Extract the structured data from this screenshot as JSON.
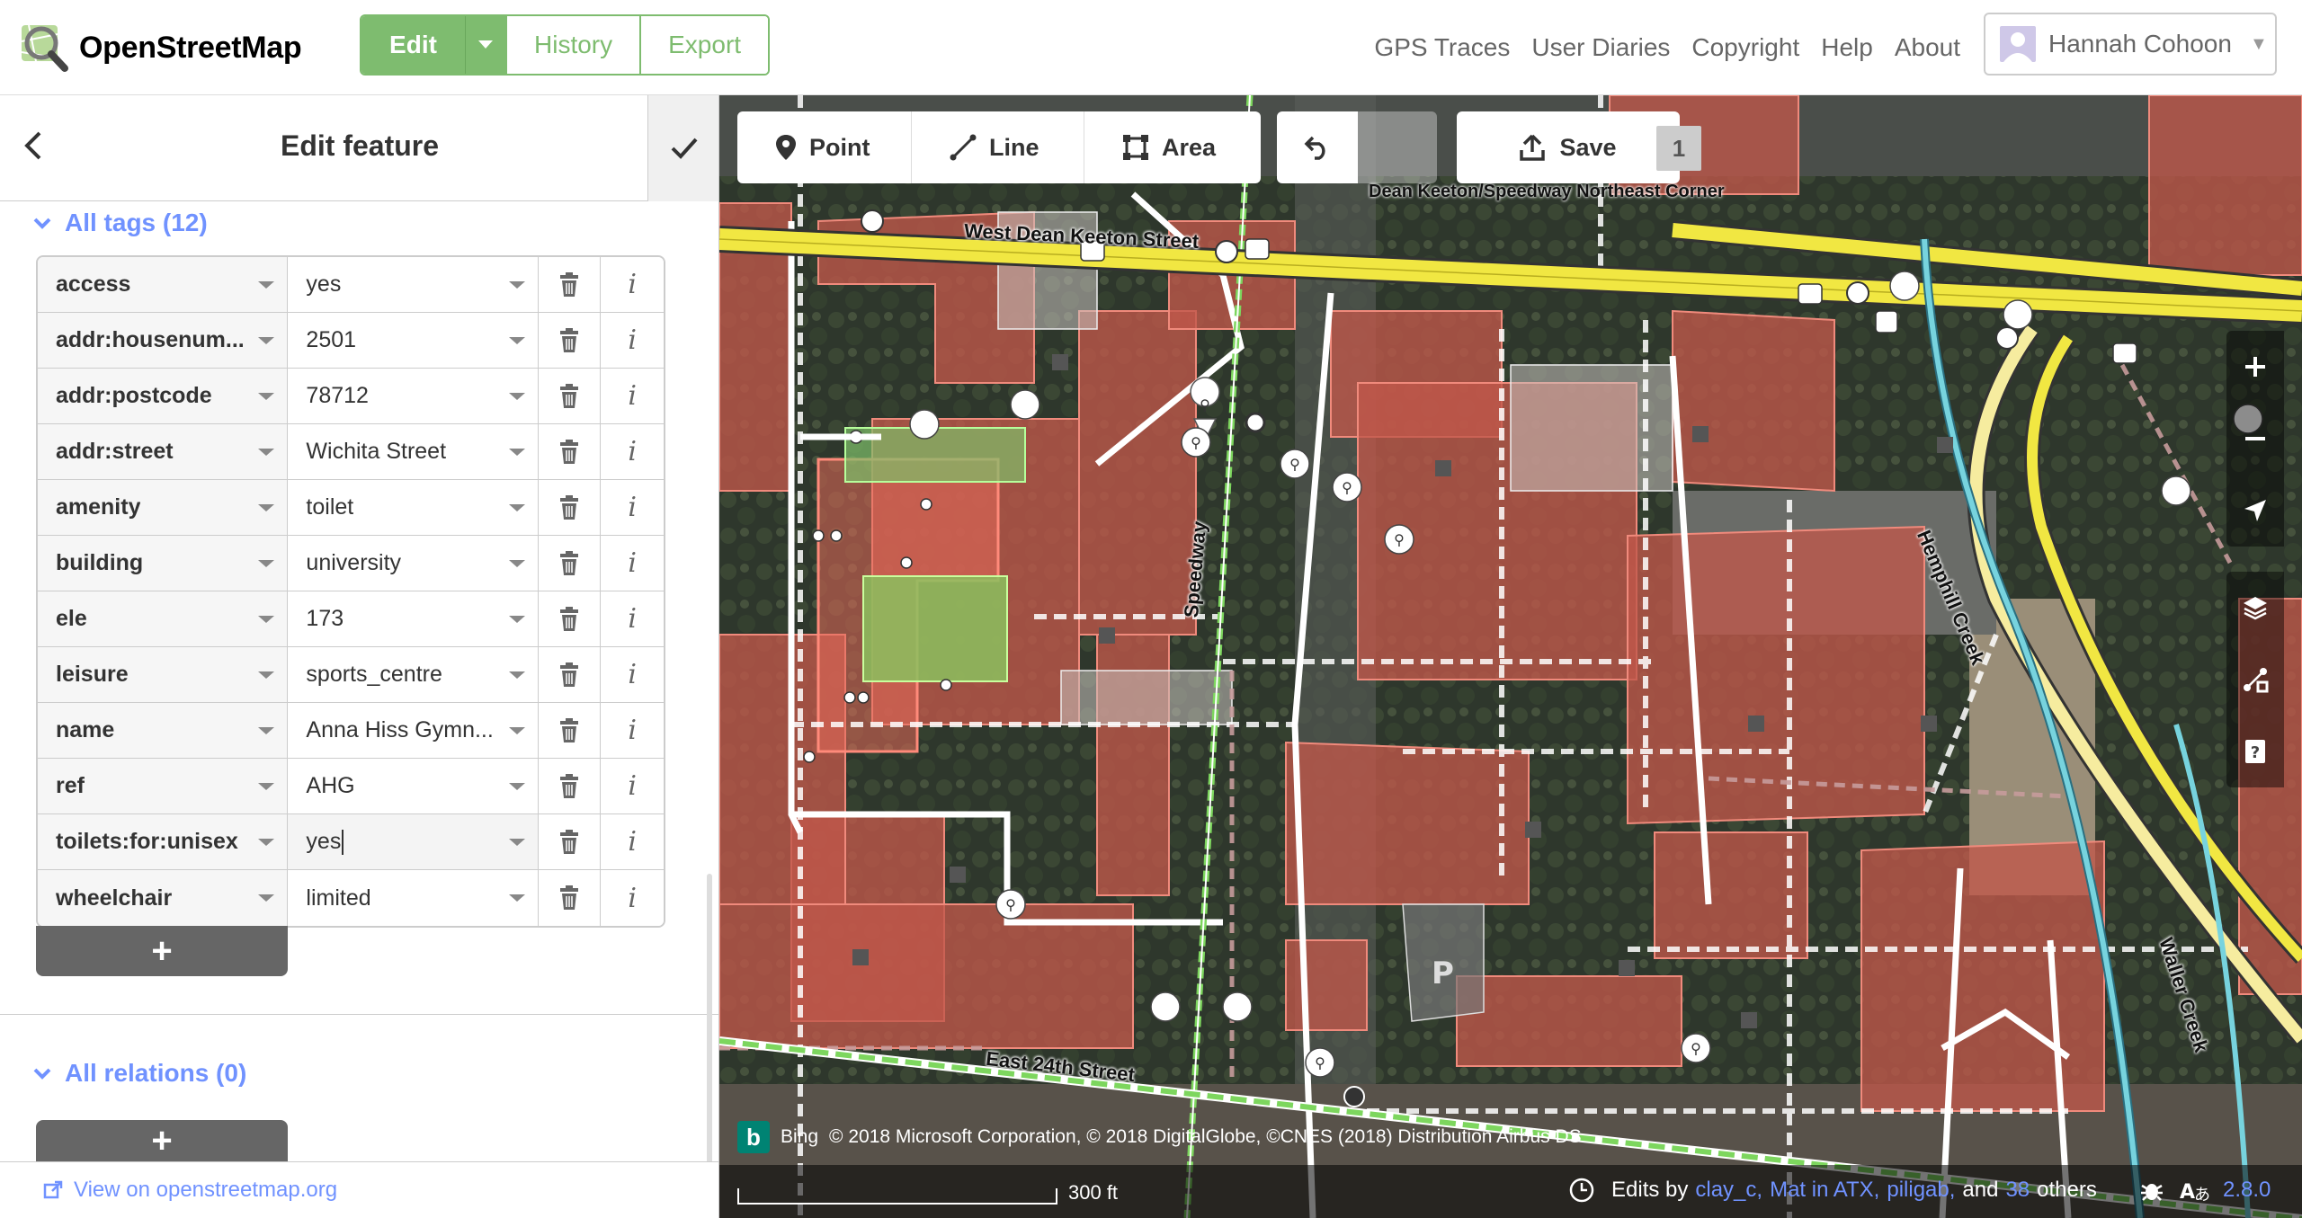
{
  "brand": {
    "name": "OpenStreetMap"
  },
  "nav": {
    "edit_label": "Edit",
    "history_label": "History",
    "export_label": "Export",
    "links": [
      "GPS Traces",
      "User Diaries",
      "Copyright",
      "Help",
      "About"
    ],
    "user_name": "Hannah Cohoon"
  },
  "sidebar": {
    "title": "Edit feature",
    "tags_header": "All tags (12)",
    "tags": [
      {
        "key": "access",
        "value": "yes"
      },
      {
        "key": "addr:housenum...",
        "value": "2501"
      },
      {
        "key": "addr:postcode",
        "value": "78712"
      },
      {
        "key": "addr:street",
        "value": "Wichita Street"
      },
      {
        "key": "amenity",
        "value": "toilet"
      },
      {
        "key": "building",
        "value": "university"
      },
      {
        "key": "ele",
        "value": "173"
      },
      {
        "key": "leisure",
        "value": "sports_centre"
      },
      {
        "key": "name",
        "value": "Anna Hiss Gymn..."
      },
      {
        "key": "ref",
        "value": "AHG"
      },
      {
        "key": "toilets:for:unisex",
        "value": "yes"
      },
      {
        "key": "wheelchair",
        "value": "limited"
      }
    ],
    "add_label": "+",
    "relations_header": "All relations (0)",
    "footer_link": "View on openstreetmap.org"
  },
  "map": {
    "tools": {
      "point": "Point",
      "line": "Line",
      "area": "Area"
    },
    "save_label": "Save",
    "save_count": "1",
    "streets": {
      "dean_keeton": "West Dean Keeton Street",
      "speedway": "Speedway",
      "e24": "East 24th Street",
      "hemphill": "Hemphill Creek",
      "waller": "Waller Creek"
    },
    "stop_label": "Dean Keeton/Speedway Northeast Corner",
    "attribution_bing": "Bing",
    "attribution": "© 2018 Microsoft Corporation, © 2018 DigitalGlobe, ©CNES (2018) Distribution Airbus DS",
    "scale_label": "300 ft",
    "edits_prefix": "Edits by",
    "editors": [
      "clay_c,",
      "Mat in ATX,",
      "piligab,"
    ],
    "edits_and": "and",
    "edits_others_count": "38",
    "edits_others": "others",
    "version": "2.8.0"
  },
  "colors": {
    "accent_green": "#7ebc6f",
    "link_blue": "#7092ff",
    "road_yellow": "#f1e742",
    "building_red": "#e06e5f",
    "waterway_blue": "#77d3de"
  }
}
